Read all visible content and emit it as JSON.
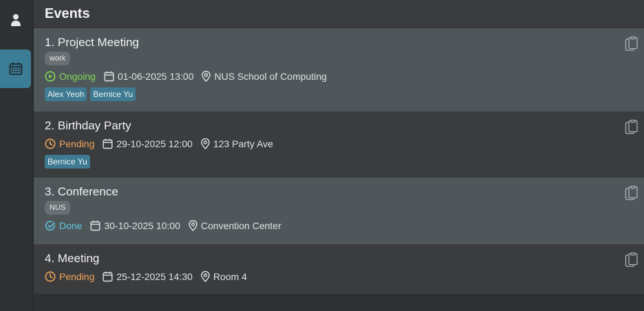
{
  "header": {
    "title": "Events"
  },
  "sidebar": {
    "items": [
      {
        "icon": "person-icon"
      },
      {
        "icon": "calendar-icon"
      }
    ]
  },
  "colors": {
    "ongoing": "#7ed957",
    "pending": "#f0a45a",
    "done": "#5ec7df",
    "accent": "#3b7d96"
  },
  "events": [
    {
      "title": "1. Project Meeting",
      "tags": [
        "work"
      ],
      "status": "Ongoing",
      "datetime": "01-06-2025 13:00",
      "location": "NUS School of Computing",
      "people": [
        "Alex Yeoh",
        "Bernice Yu"
      ]
    },
    {
      "title": "2. Birthday Party",
      "tags": [],
      "status": "Pending",
      "datetime": "29-10-2025 12:00",
      "location": "123 Party Ave",
      "people": [
        "Bernice Yu"
      ]
    },
    {
      "title": "3. Conference",
      "tags": [
        "NUS"
      ],
      "status": "Done",
      "datetime": "30-10-2025 10:00",
      "location": "Convention Center",
      "people": []
    },
    {
      "title": "4. Meeting",
      "tags": [],
      "status": "Pending",
      "datetime": "25-12-2025 14:30",
      "location": "Room 4",
      "people": []
    }
  ]
}
